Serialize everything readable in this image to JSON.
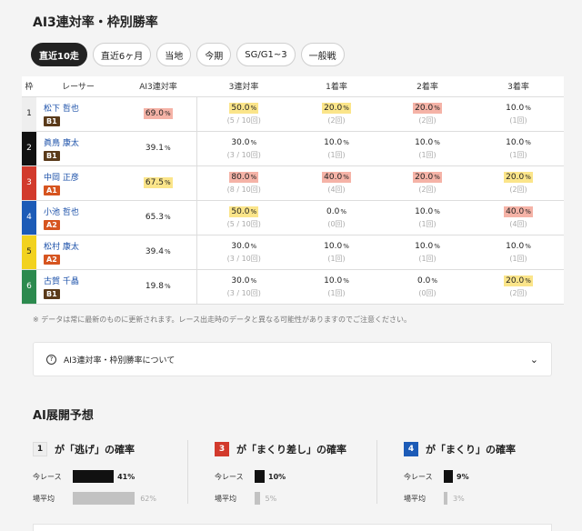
{
  "title": "AI3連対率・枠別勝率",
  "tabs": [
    "直近10走",
    "直近6ヶ月",
    "当地",
    "今期",
    "SG/G1~3",
    "一般戦"
  ],
  "table": {
    "headers": [
      "枠",
      "レーサー",
      "AI3連対率",
      "3連対率",
      "1着率",
      "2着率",
      "3着率"
    ],
    "rows": [
      {
        "frame": "1",
        "name": "松下 哲也",
        "class": "B1",
        "ai": "69.0",
        "ai_hl": "red",
        "r3": "50.0",
        "r3_sub": "(5 / 10回)",
        "r3_hl": "yel",
        "w1": "20.0",
        "w1_sub": "(2回)",
        "w1_hl": "yel",
        "w2": "20.0",
        "w2_sub": "(2回)",
        "w2_hl": "red",
        "w3": "10.0",
        "w3_sub": "(1回)",
        "w3_hl": ""
      },
      {
        "frame": "2",
        "name": "眞鳥 康太",
        "class": "B1",
        "ai": "39.1",
        "ai_hl": "",
        "r3": "30.0",
        "r3_sub": "(3 / 10回)",
        "r3_hl": "",
        "w1": "10.0",
        "w1_sub": "(1回)",
        "w1_hl": "",
        "w2": "10.0",
        "w2_sub": "(1回)",
        "w2_hl": "",
        "w3": "10.0",
        "w3_sub": "(1回)",
        "w3_hl": ""
      },
      {
        "frame": "3",
        "name": "中岡 正彦",
        "class": "A1",
        "ai": "67.5",
        "ai_hl": "yel",
        "r3": "80.0",
        "r3_sub": "(8 / 10回)",
        "r3_hl": "red",
        "w1": "40.0",
        "w1_sub": "(4回)",
        "w1_hl": "red",
        "w2": "20.0",
        "w2_sub": "(2回)",
        "w2_hl": "red",
        "w3": "20.0",
        "w3_sub": "(2回)",
        "w3_hl": "yel"
      },
      {
        "frame": "4",
        "name": "小池 哲也",
        "class": "A2",
        "ai": "65.3",
        "ai_hl": "",
        "r3": "50.0",
        "r3_sub": "(5 / 10回)",
        "r3_hl": "yel",
        "w1": "0.0",
        "w1_sub": "(0回)",
        "w1_hl": "",
        "w2": "10.0",
        "w2_sub": "(1回)",
        "w2_hl": "",
        "w3": "40.0",
        "w3_sub": "(4回)",
        "w3_hl": "red"
      },
      {
        "frame": "5",
        "name": "松村 康太",
        "class": "A2",
        "ai": "39.4",
        "ai_hl": "",
        "r3": "30.0",
        "r3_sub": "(3 / 10回)",
        "r3_hl": "",
        "w1": "10.0",
        "w1_sub": "(1回)",
        "w1_hl": "",
        "w2": "10.0",
        "w2_sub": "(1回)",
        "w2_hl": "",
        "w3": "10.0",
        "w3_sub": "(1回)",
        "w3_hl": ""
      },
      {
        "frame": "6",
        "name": "古賀 千晶",
        "class": "B1",
        "ai": "19.8",
        "ai_hl": "",
        "r3": "30.0",
        "r3_sub": "(3 / 10回)",
        "r3_hl": "",
        "w1": "10.0",
        "w1_sub": "(1回)",
        "w1_hl": "",
        "w2": "0.0",
        "w2_sub": "(0回)",
        "w2_hl": "",
        "w3": "20.0",
        "w3_sub": "(2回)",
        "w3_hl": "yel"
      }
    ],
    "percent_unit": "%"
  },
  "note": "※ データは常に最新のものに更新されます。レース出走時のデータと異なる可能性がありますのでご注意ください。",
  "accordion": {
    "label": "AI3連対率・枠別勝率について"
  },
  "section_title": "AI展開予想",
  "predictions": [
    {
      "frame": "1",
      "title": "が「逃げ」の確率",
      "now_label": "今レース",
      "now_value": "41%",
      "now_frac": 0.41,
      "avg_label": "場平均",
      "avg_value": "62%",
      "avg_frac": 0.62
    },
    {
      "frame": "3",
      "title": "が「まくり差し」の確率",
      "now_label": "今レース",
      "now_value": "10%",
      "now_frac": 0.1,
      "avg_label": "場平均",
      "avg_value": "5%",
      "avg_frac": 0.05
    },
    {
      "frame": "4",
      "title": "が「まくり」の確率",
      "now_label": "今レース",
      "now_value": "9%",
      "now_frac": 0.09,
      "avg_label": "場平均",
      "avg_value": "3%",
      "avg_frac": 0.03
    }
  ],
  "colors": {
    "highlight_red": "#f5b3a7",
    "highlight_yellow": "#fbe58a",
    "link": "#1a4fa8"
  }
}
